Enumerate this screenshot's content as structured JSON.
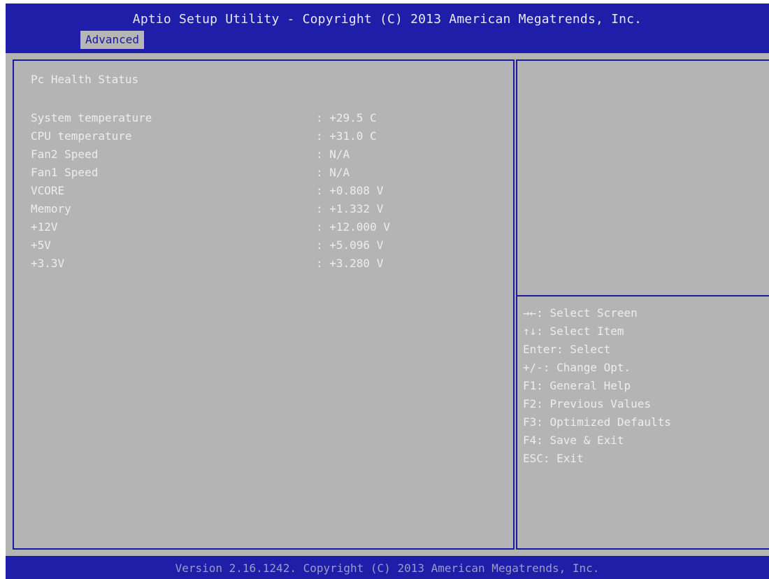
{
  "header": {
    "title": "Aptio Setup Utility - Copyright (C) 2013 American Megatrends, Inc.",
    "tabs": [
      "Advanced"
    ]
  },
  "main": {
    "section_title": "Pc Health Status",
    "rows": [
      {
        "label": "System temperature",
        "value": ": +29.5 C"
      },
      {
        "label": "CPU temperature",
        "value": ": +31.0 C"
      },
      {
        "label": "Fan2 Speed",
        "value": ": N/A"
      },
      {
        "label": "Fan1 Speed",
        "value": ": N/A"
      },
      {
        "label": "VCORE",
        "value": ": +0.808 V"
      },
      {
        "label": "Memory",
        "value": ": +1.332 V"
      },
      {
        "label": "+12V",
        "value": ": +12.000 V"
      },
      {
        "label": "+5V",
        "value": ": +5.096 V"
      },
      {
        "label": "+3.3V",
        "value": ": +3.280 V"
      }
    ]
  },
  "help": {
    "lines": [
      "→←: Select Screen",
      "↑↓: Select Item",
      "Enter: Select",
      "+/-: Change Opt.",
      "F1: General Help",
      "F2: Previous Values",
      "F3: Optimized Defaults",
      "F4: Save & Exit",
      "ESC: Exit"
    ]
  },
  "footer": {
    "text": "Version 2.16.1242. Copyright (C) 2013 American Megatrends, Inc."
  },
  "colors": {
    "background_blue": "#1e1ea8",
    "panel_gray": "#b4b4b4",
    "text_light": "#ededed",
    "tab_bg": "#b6b6b6",
    "border_blue": "#1a1a9c"
  }
}
